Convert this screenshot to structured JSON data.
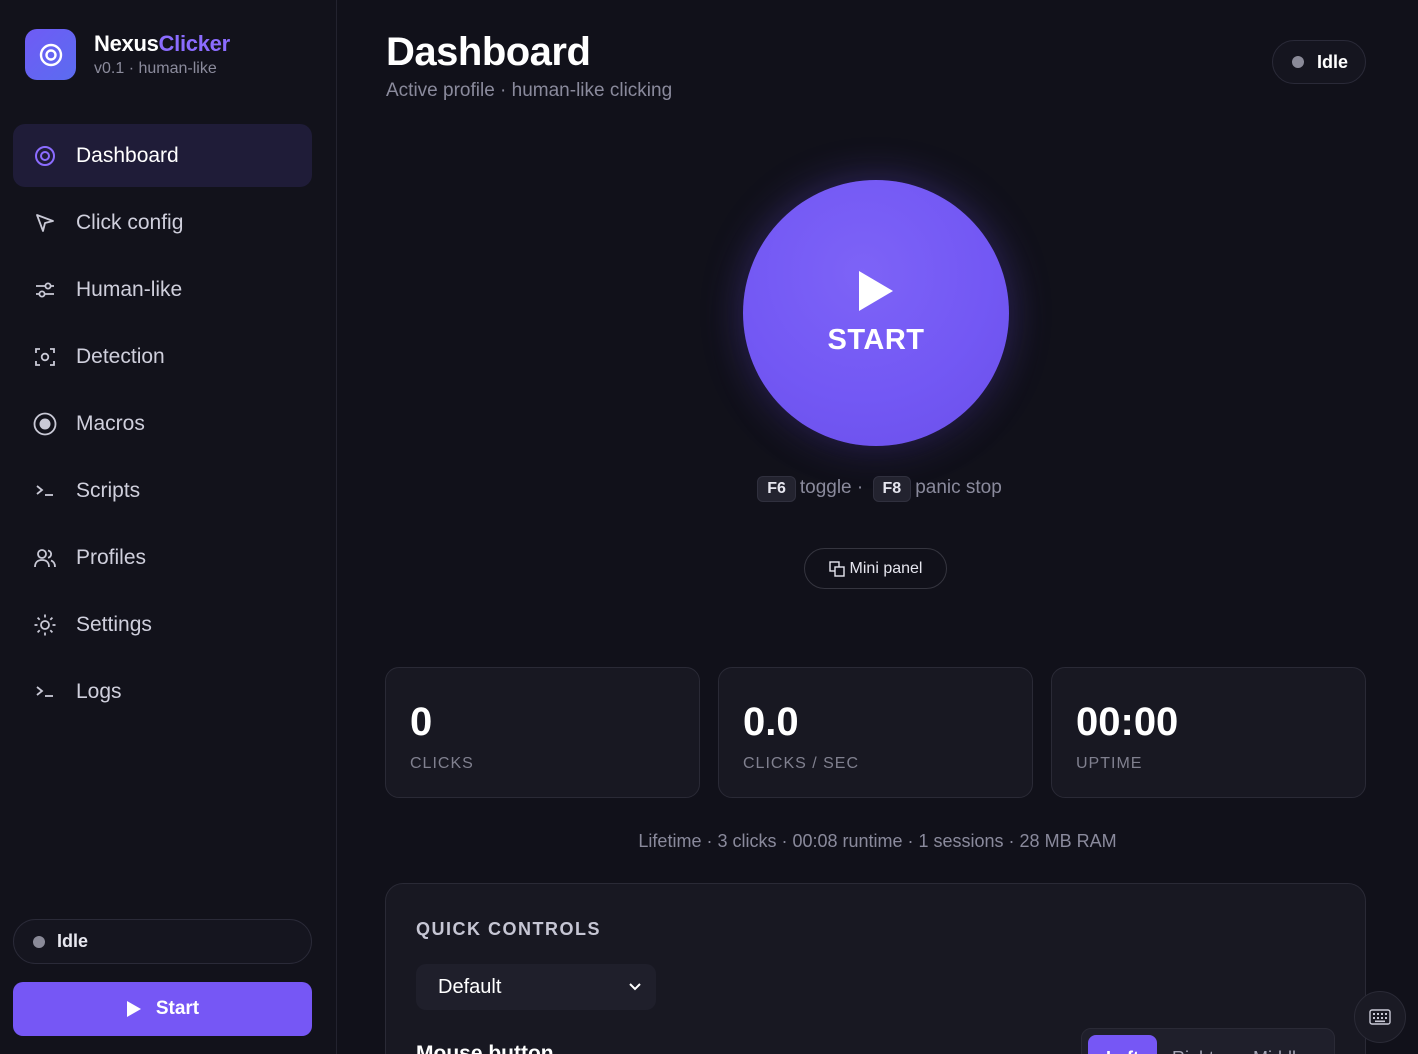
{
  "brand": {
    "name_main": "Nexus",
    "name_accent": "Clicker",
    "subtitle": "v0.1 · human-like"
  },
  "sidebar": {
    "items": [
      {
        "label": "Dashboard",
        "icon": "target-icon",
        "active": true
      },
      {
        "label": "Click config",
        "icon": "cursor-icon"
      },
      {
        "label": "Human-like",
        "icon": "sliders-icon"
      },
      {
        "label": "Detection",
        "icon": "scan-icon"
      },
      {
        "label": "Macros",
        "icon": "record-icon"
      },
      {
        "label": "Scripts",
        "icon": "terminal-icon"
      },
      {
        "label": "Profiles",
        "icon": "users-icon"
      },
      {
        "label": "Settings",
        "icon": "sun-icon"
      },
      {
        "label": "Logs",
        "icon": "terminal-icon"
      }
    ],
    "status": "Idle",
    "start_label": "Start"
  },
  "header": {
    "title": "Dashboard",
    "subtitle": "Active profile · human-like clicking",
    "status": "Idle"
  },
  "start_button": {
    "label": "START"
  },
  "hotkeys": {
    "toggle_key": "F6",
    "toggle_text": "toggle ·",
    "panic_key": "F8",
    "panic_text": "panic stop"
  },
  "mini_panel": {
    "label": "Mini panel"
  },
  "stats": [
    {
      "value": "0",
      "caption": "CLICKS"
    },
    {
      "value": "0.0",
      "caption": "CLICKS / SEC"
    },
    {
      "value": "00:00",
      "caption": "UPTIME"
    }
  ],
  "lifetime": "Lifetime · 3 clicks · 00:08 runtime · 1 sessions · 28 MB RAM",
  "quick_controls": {
    "title": "QUICK CONTROLS",
    "profile_selected": "Default",
    "mouse_button_label": "Mouse button",
    "mouse_buttons": [
      "Left",
      "Right",
      "Middle"
    ],
    "mouse_button_selected": "Left"
  },
  "colors": {
    "accent": "#7657f5",
    "background": "#11111a",
    "status_idle": "#8a8a98"
  }
}
